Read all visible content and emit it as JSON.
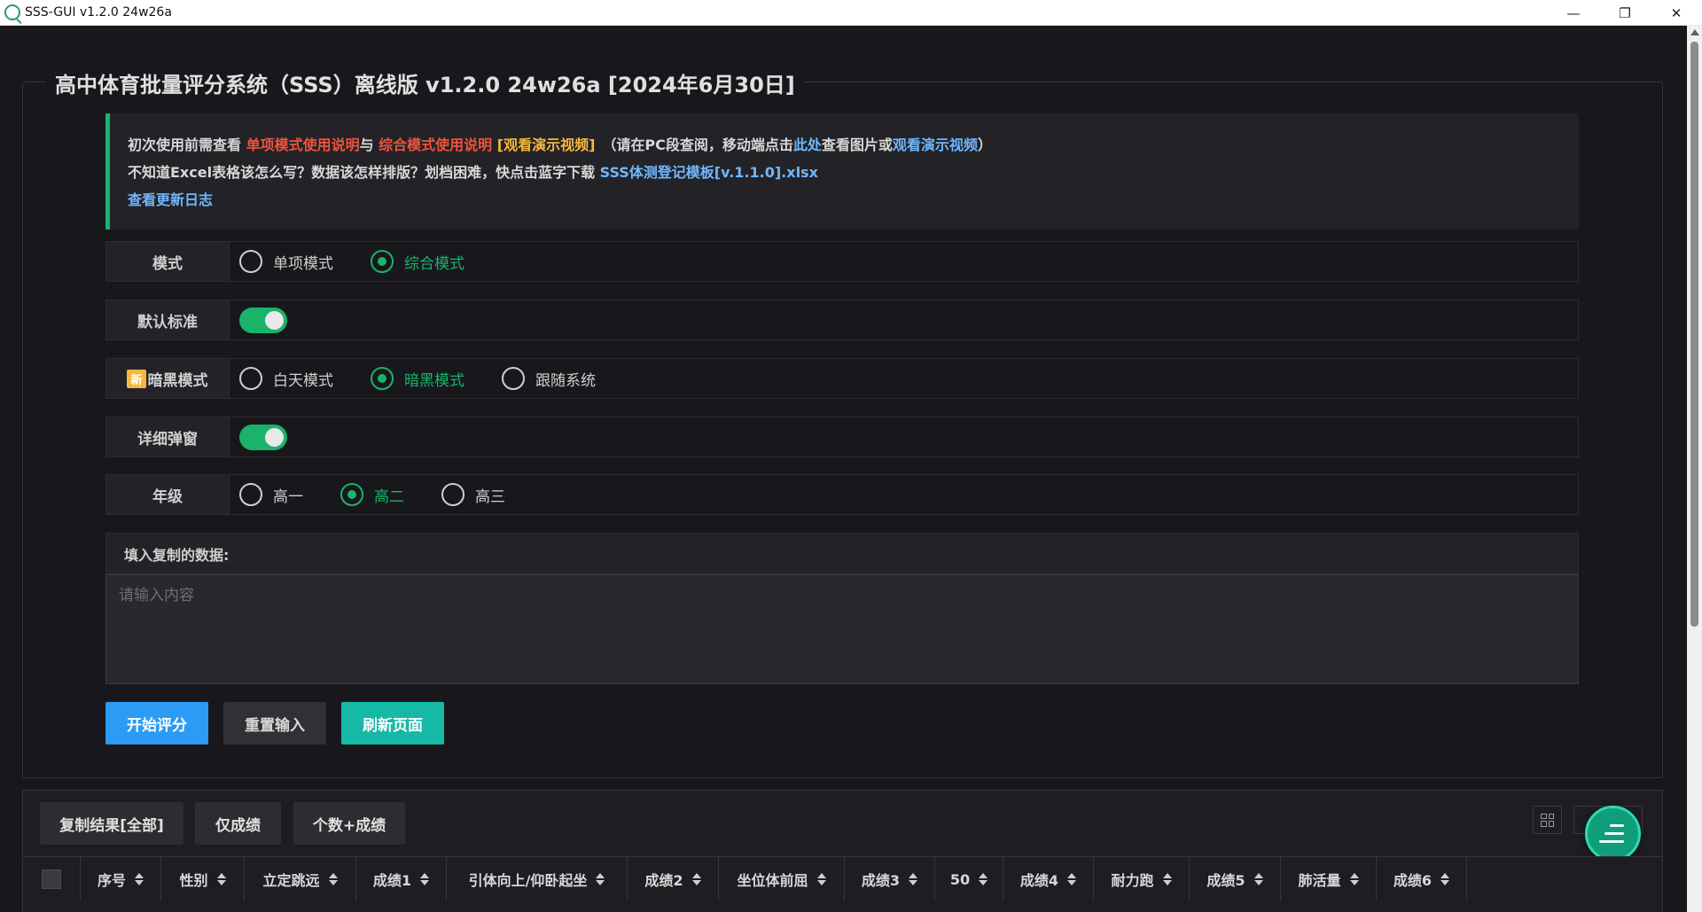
{
  "window": {
    "title": "SSS-GUI v1.2.0 24w26a",
    "minimize": "—",
    "restore": "❐",
    "close": "✕"
  },
  "page": {
    "heading": "高中体育批量评分系统（SSS）离线版 v1.2.0 24w26a [2024年6月30日]"
  },
  "notice": {
    "line1_prefix": "初次使用前需查看 ",
    "link_single": "单项模式使用说明",
    "line1_and": "与 ",
    "link_combined": "综合模式使用说明",
    "link_video": "[观看演示视频]",
    "line1_pc": "　（请在PC段查阅，移动端点击",
    "link_here": "此处",
    "line1_view": "查看图片或",
    "link_video2": "观看演示视频",
    "line1_end": "）",
    "line2_prefix": "不知道Excel表格该怎么写？数据该怎样排版？划档困难，快点击蓝字下载 ",
    "link_template": "SSS体测登记模板[v.1.1.0].xlsx",
    "link_changelog": "查看更新日志"
  },
  "settings": {
    "mode": {
      "label": "模式",
      "options": [
        "单项模式",
        "综合模式"
      ],
      "selected": "综合模式"
    },
    "default_standard": {
      "label": "默认标准",
      "on": true
    },
    "dark_mode": {
      "badge": "新",
      "label": "暗黑模式",
      "options": [
        "白天模式",
        "暗黑模式",
        "跟随系统"
      ],
      "selected": "暗黑模式"
    },
    "detail_popup": {
      "label": "详细弹窗",
      "on": true
    },
    "grade": {
      "label": "年级",
      "options": [
        "高一",
        "高二",
        "高三"
      ],
      "selected": "高二"
    }
  },
  "input": {
    "label": "填入复制的数据:",
    "placeholder": "请输入内容"
  },
  "actions": {
    "start": "开始评分",
    "reset": "重置输入",
    "refresh": "刷新页面"
  },
  "results": {
    "copy_all": "复制结果[全部]",
    "scores_only": "仅成绩",
    "count_and_scores": "个数+成绩",
    "columns": [
      "序号",
      "性别",
      "立定跳远",
      "成绩1",
      "引体向上/仰卧起坐",
      "成绩2",
      "坐位体前屈",
      "成绩3",
      "50",
      "成绩4",
      "耐力跑",
      "成绩5",
      "肺活量",
      "成绩6"
    ]
  }
}
